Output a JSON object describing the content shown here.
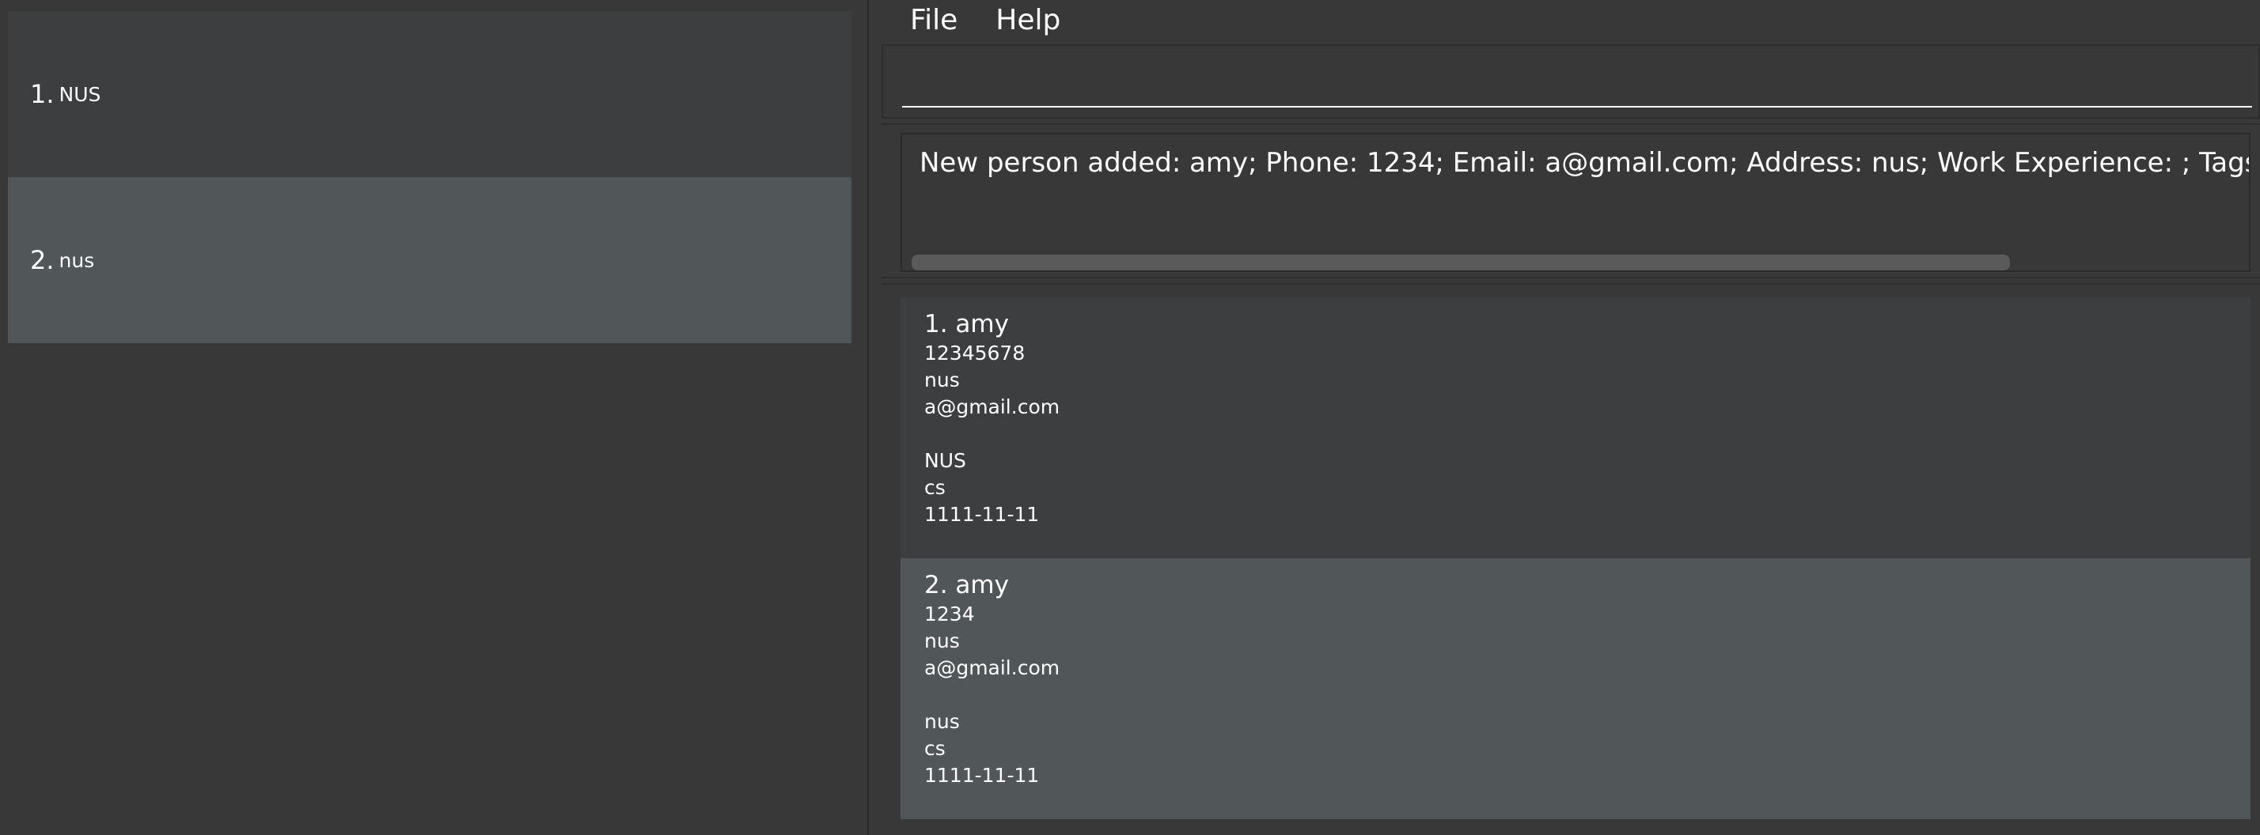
{
  "menu": {
    "file_label": "File",
    "help_label": "Help"
  },
  "universities": [
    {
      "index": "1.",
      "name": "NUS"
    },
    {
      "index": "2.",
      "name": "nus"
    }
  ],
  "command": {
    "value": "",
    "placeholder": ""
  },
  "result": {
    "message": "New person added: amy; Phone: 1234; Email: a@gmail.com; Address: nus; Work Experience: ; Tags: []; University: nus"
  },
  "persons": [
    {
      "index_name": "1. amy",
      "phone": "12345678",
      "address": "nus",
      "email": "a@gmail.com",
      "university": "NUS",
      "major": "cs",
      "date": "1111-11-11"
    },
    {
      "index_name": "2. amy",
      "phone": "1234",
      "address": "nus",
      "email": "a@gmail.com",
      "university": "nus",
      "major": "cs",
      "date": "1111-11-11"
    }
  ]
}
